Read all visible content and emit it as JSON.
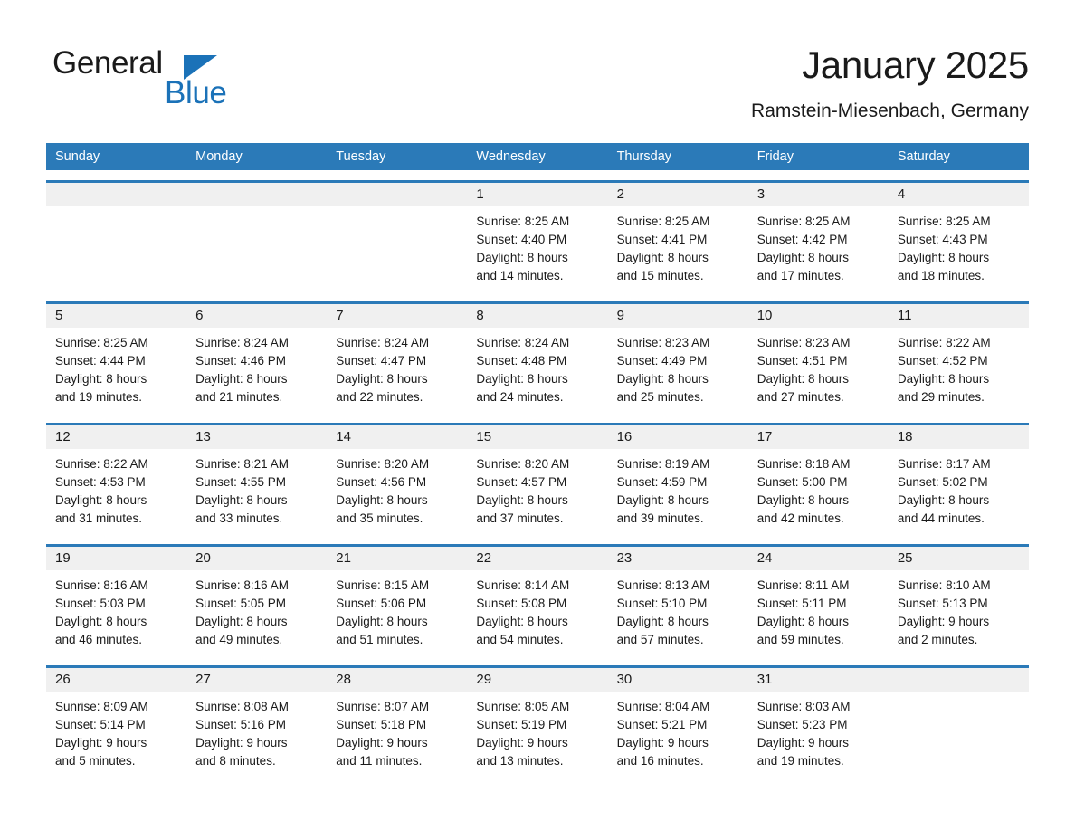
{
  "brand": {
    "name_top": "General",
    "name_bottom": "Blue",
    "color_black": "#1a1a1a",
    "color_blue": "#1b72b8"
  },
  "header": {
    "title": "January 2025",
    "subtitle": "Ramstein-Miesenbach, Germany"
  },
  "theme": {
    "header_bg": "#2b7ab8",
    "header_text": "#ffffff",
    "week_rule": "#2b7ab8",
    "daynum_bg": "#f0f0f0",
    "body_text": "#1a1a1a"
  },
  "weekdays": [
    "Sunday",
    "Monday",
    "Tuesday",
    "Wednesday",
    "Thursday",
    "Friday",
    "Saturday"
  ],
  "weeks": [
    {
      "days": [
        {
          "number": "",
          "lines": [
            "",
            "",
            "",
            ""
          ]
        },
        {
          "number": "",
          "lines": [
            "",
            "",
            "",
            ""
          ]
        },
        {
          "number": "",
          "lines": [
            "",
            "",
            "",
            ""
          ]
        },
        {
          "number": "1",
          "lines": [
            "Sunrise: 8:25 AM",
            "Sunset: 4:40 PM",
            "Daylight: 8 hours",
            "and 14 minutes."
          ]
        },
        {
          "number": "2",
          "lines": [
            "Sunrise: 8:25 AM",
            "Sunset: 4:41 PM",
            "Daylight: 8 hours",
            "and 15 minutes."
          ]
        },
        {
          "number": "3",
          "lines": [
            "Sunrise: 8:25 AM",
            "Sunset: 4:42 PM",
            "Daylight: 8 hours",
            "and 17 minutes."
          ]
        },
        {
          "number": "4",
          "lines": [
            "Sunrise: 8:25 AM",
            "Sunset: 4:43 PM",
            "Daylight: 8 hours",
            "and 18 minutes."
          ]
        }
      ]
    },
    {
      "days": [
        {
          "number": "5",
          "lines": [
            "Sunrise: 8:25 AM",
            "Sunset: 4:44 PM",
            "Daylight: 8 hours",
            "and 19 minutes."
          ]
        },
        {
          "number": "6",
          "lines": [
            "Sunrise: 8:24 AM",
            "Sunset: 4:46 PM",
            "Daylight: 8 hours",
            "and 21 minutes."
          ]
        },
        {
          "number": "7",
          "lines": [
            "Sunrise: 8:24 AM",
            "Sunset: 4:47 PM",
            "Daylight: 8 hours",
            "and 22 minutes."
          ]
        },
        {
          "number": "8",
          "lines": [
            "Sunrise: 8:24 AM",
            "Sunset: 4:48 PM",
            "Daylight: 8 hours",
            "and 24 minutes."
          ]
        },
        {
          "number": "9",
          "lines": [
            "Sunrise: 8:23 AM",
            "Sunset: 4:49 PM",
            "Daylight: 8 hours",
            "and 25 minutes."
          ]
        },
        {
          "number": "10",
          "lines": [
            "Sunrise: 8:23 AM",
            "Sunset: 4:51 PM",
            "Daylight: 8 hours",
            "and 27 minutes."
          ]
        },
        {
          "number": "11",
          "lines": [
            "Sunrise: 8:22 AM",
            "Sunset: 4:52 PM",
            "Daylight: 8 hours",
            "and 29 minutes."
          ]
        }
      ]
    },
    {
      "days": [
        {
          "number": "12",
          "lines": [
            "Sunrise: 8:22 AM",
            "Sunset: 4:53 PM",
            "Daylight: 8 hours",
            "and 31 minutes."
          ]
        },
        {
          "number": "13",
          "lines": [
            "Sunrise: 8:21 AM",
            "Sunset: 4:55 PM",
            "Daylight: 8 hours",
            "and 33 minutes."
          ]
        },
        {
          "number": "14",
          "lines": [
            "Sunrise: 8:20 AM",
            "Sunset: 4:56 PM",
            "Daylight: 8 hours",
            "and 35 minutes."
          ]
        },
        {
          "number": "15",
          "lines": [
            "Sunrise: 8:20 AM",
            "Sunset: 4:57 PM",
            "Daylight: 8 hours",
            "and 37 minutes."
          ]
        },
        {
          "number": "16",
          "lines": [
            "Sunrise: 8:19 AM",
            "Sunset: 4:59 PM",
            "Daylight: 8 hours",
            "and 39 minutes."
          ]
        },
        {
          "number": "17",
          "lines": [
            "Sunrise: 8:18 AM",
            "Sunset: 5:00 PM",
            "Daylight: 8 hours",
            "and 42 minutes."
          ]
        },
        {
          "number": "18",
          "lines": [
            "Sunrise: 8:17 AM",
            "Sunset: 5:02 PM",
            "Daylight: 8 hours",
            "and 44 minutes."
          ]
        }
      ]
    },
    {
      "days": [
        {
          "number": "19",
          "lines": [
            "Sunrise: 8:16 AM",
            "Sunset: 5:03 PM",
            "Daylight: 8 hours",
            "and 46 minutes."
          ]
        },
        {
          "number": "20",
          "lines": [
            "Sunrise: 8:16 AM",
            "Sunset: 5:05 PM",
            "Daylight: 8 hours",
            "and 49 minutes."
          ]
        },
        {
          "number": "21",
          "lines": [
            "Sunrise: 8:15 AM",
            "Sunset: 5:06 PM",
            "Daylight: 8 hours",
            "and 51 minutes."
          ]
        },
        {
          "number": "22",
          "lines": [
            "Sunrise: 8:14 AM",
            "Sunset: 5:08 PM",
            "Daylight: 8 hours",
            "and 54 minutes."
          ]
        },
        {
          "number": "23",
          "lines": [
            "Sunrise: 8:13 AM",
            "Sunset: 5:10 PM",
            "Daylight: 8 hours",
            "and 57 minutes."
          ]
        },
        {
          "number": "24",
          "lines": [
            "Sunrise: 8:11 AM",
            "Sunset: 5:11 PM",
            "Daylight: 8 hours",
            "and 59 minutes."
          ]
        },
        {
          "number": "25",
          "lines": [
            "Sunrise: 8:10 AM",
            "Sunset: 5:13 PM",
            "Daylight: 9 hours",
            "and 2 minutes."
          ]
        }
      ]
    },
    {
      "days": [
        {
          "number": "26",
          "lines": [
            "Sunrise: 8:09 AM",
            "Sunset: 5:14 PM",
            "Daylight: 9 hours",
            "and 5 minutes."
          ]
        },
        {
          "number": "27",
          "lines": [
            "Sunrise: 8:08 AM",
            "Sunset: 5:16 PM",
            "Daylight: 9 hours",
            "and 8 minutes."
          ]
        },
        {
          "number": "28",
          "lines": [
            "Sunrise: 8:07 AM",
            "Sunset: 5:18 PM",
            "Daylight: 9 hours",
            "and 11 minutes."
          ]
        },
        {
          "number": "29",
          "lines": [
            "Sunrise: 8:05 AM",
            "Sunset: 5:19 PM",
            "Daylight: 9 hours",
            "and 13 minutes."
          ]
        },
        {
          "number": "30",
          "lines": [
            "Sunrise: 8:04 AM",
            "Sunset: 5:21 PM",
            "Daylight: 9 hours",
            "and 16 minutes."
          ]
        },
        {
          "number": "31",
          "lines": [
            "Sunrise: 8:03 AM",
            "Sunset: 5:23 PM",
            "Daylight: 9 hours",
            "and 19 minutes."
          ]
        },
        {
          "number": "",
          "lines": [
            "",
            "",
            "",
            ""
          ]
        }
      ]
    }
  ]
}
